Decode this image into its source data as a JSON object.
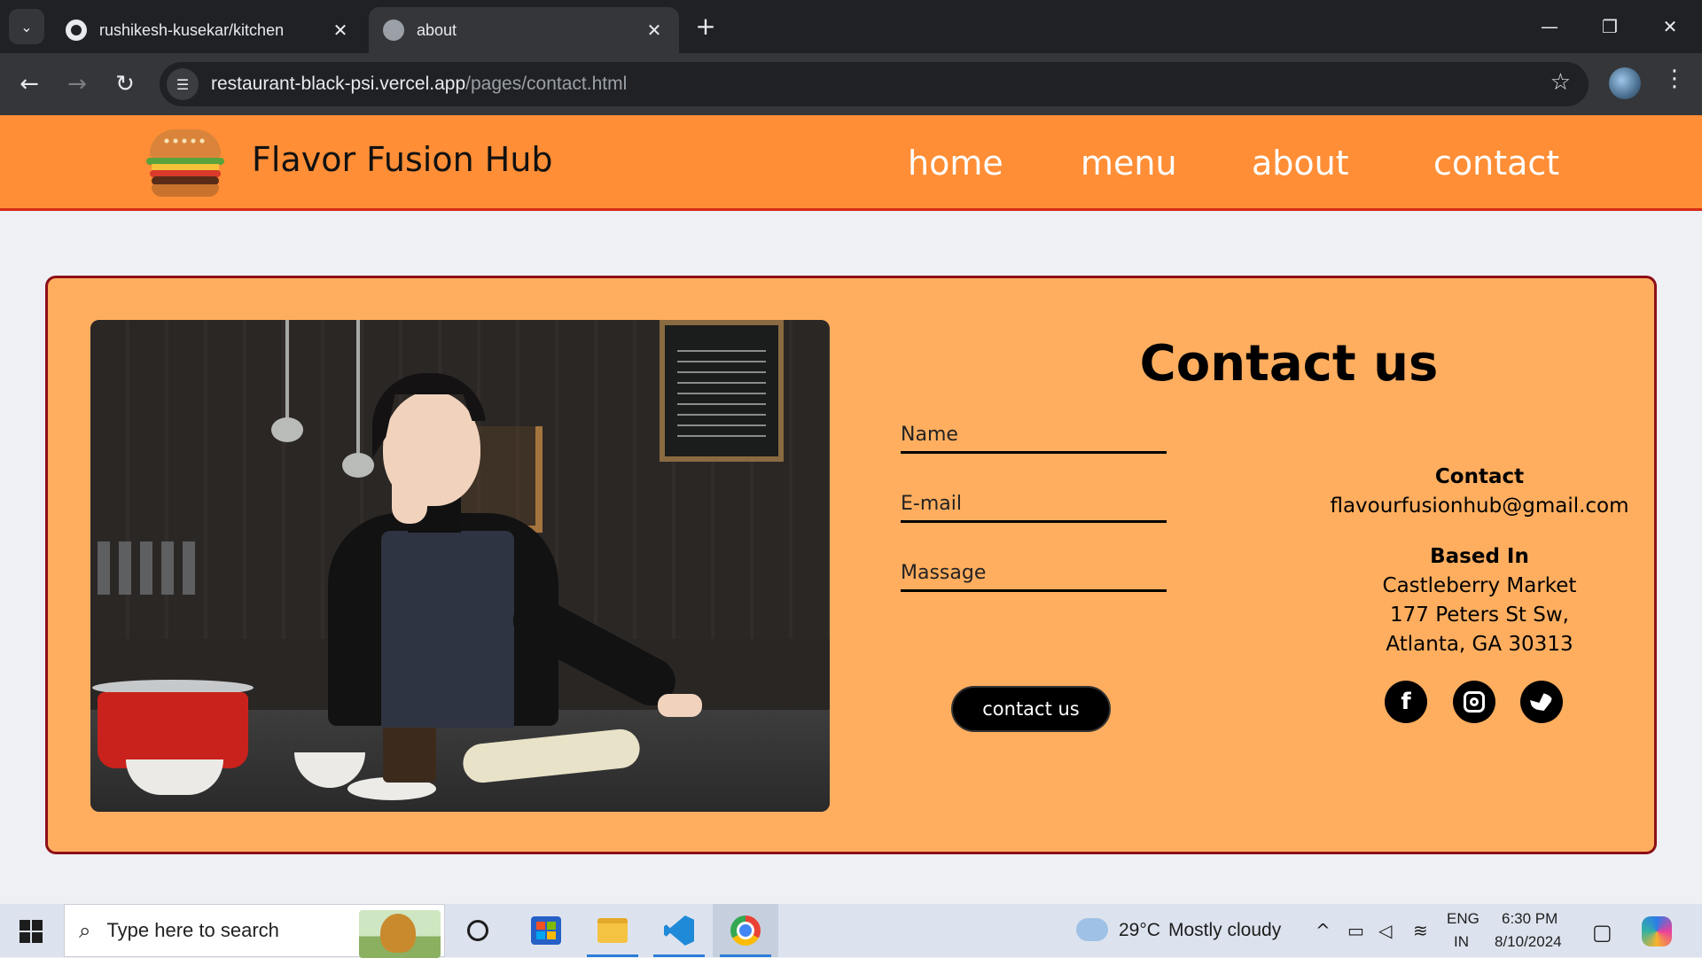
{
  "browser": {
    "tabs": [
      {
        "title": "rushikesh-kusekar/kitchen",
        "icon": "github-icon",
        "active": false
      },
      {
        "title": "about",
        "icon": "globe-icon",
        "active": true
      }
    ],
    "new_tab_label": "+",
    "window_controls": {
      "minimize": "—",
      "restore": "❐",
      "close": "✕"
    },
    "url": {
      "domain": "restaurant-black-psi.vercel.app",
      "path": "/pages/contact.html"
    }
  },
  "site": {
    "brand": "Flavor Fusion Hub",
    "logo_icon": "burger-icon",
    "nav": [
      {
        "label": "home"
      },
      {
        "label": "menu"
      },
      {
        "label": "about"
      },
      {
        "label": "contact"
      }
    ],
    "colors": {
      "header": "#ff8e36",
      "card": "#ffae5f",
      "card_border": "#8d0f17"
    }
  },
  "contact": {
    "title": "Contact us",
    "form": {
      "name_placeholder": "Name",
      "email_placeholder": "E-mail",
      "message_placeholder": "Massage",
      "submit_label": "contact us"
    },
    "info": {
      "contact_heading": "Contact",
      "email": "flavourfusionhub@gmail.com",
      "based_heading": "Based In",
      "address": [
        "Castleberry Market",
        "177 Peters St Sw,",
        "Atlanta, GA 30313"
      ]
    },
    "social": [
      {
        "name": "facebook-icon",
        "glyph": "f"
      },
      {
        "name": "instagram-icon"
      },
      {
        "name": "twitter-icon"
      }
    ]
  },
  "taskbar": {
    "search_placeholder": "Type here to search",
    "weather": {
      "temp": "29°C",
      "condition": "Mostly cloudy"
    },
    "language": {
      "line1": "ENG",
      "line2": "IN"
    },
    "clock": {
      "time": "6:30 PM",
      "date": "8/10/2024"
    }
  }
}
